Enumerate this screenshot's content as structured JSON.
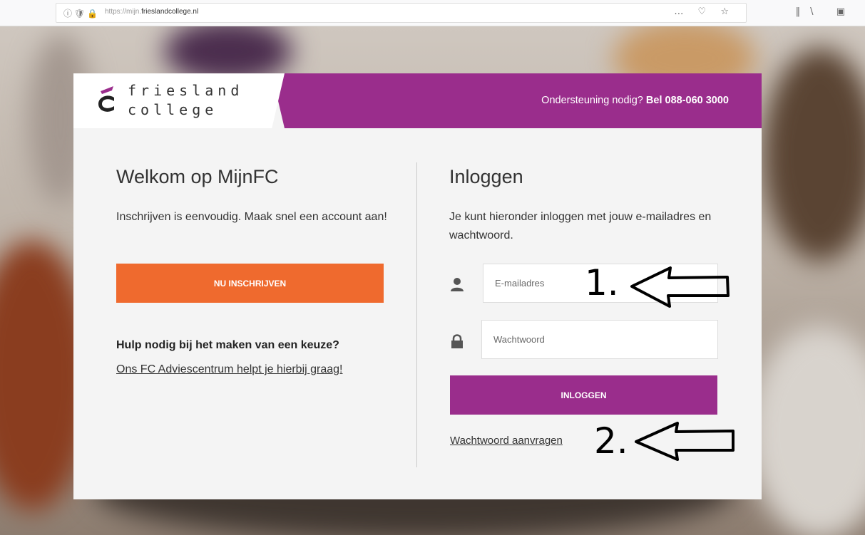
{
  "browser": {
    "url_prefix": "https://mijn.",
    "url_domain": "frieslandcollege.nl",
    "more_icon": "…"
  },
  "header": {
    "logo_line1": "friesland",
    "logo_line2": "college",
    "support_text": "Ondersteuning nodig?",
    "support_phone": "Bel 088-060 3000"
  },
  "welcome": {
    "title": "Welkom op MijnFC",
    "description": "Inschrijven is eenvoudig. Maak snel een account aan!",
    "signup_button": "NU INSCHRIJVEN",
    "help_heading": "Hulp nodig bij het maken van een keuze?",
    "help_link": "Ons FC Adviescentrum helpt je hierbij graag!"
  },
  "login": {
    "title": "Inloggen",
    "description": "Je kunt hieronder inloggen met jouw e-mailadres en wachtwoord.",
    "email_placeholder": "E-mailadres",
    "password_placeholder": "Wachtwoord",
    "login_button": "INLOGGEN",
    "forgot_link": "Wachtwoord aanvragen"
  },
  "annotations": {
    "step1": "1.",
    "step2": "2."
  },
  "colors": {
    "brand_purple": "#9a2d8c",
    "brand_orange": "#ef6a2e"
  }
}
